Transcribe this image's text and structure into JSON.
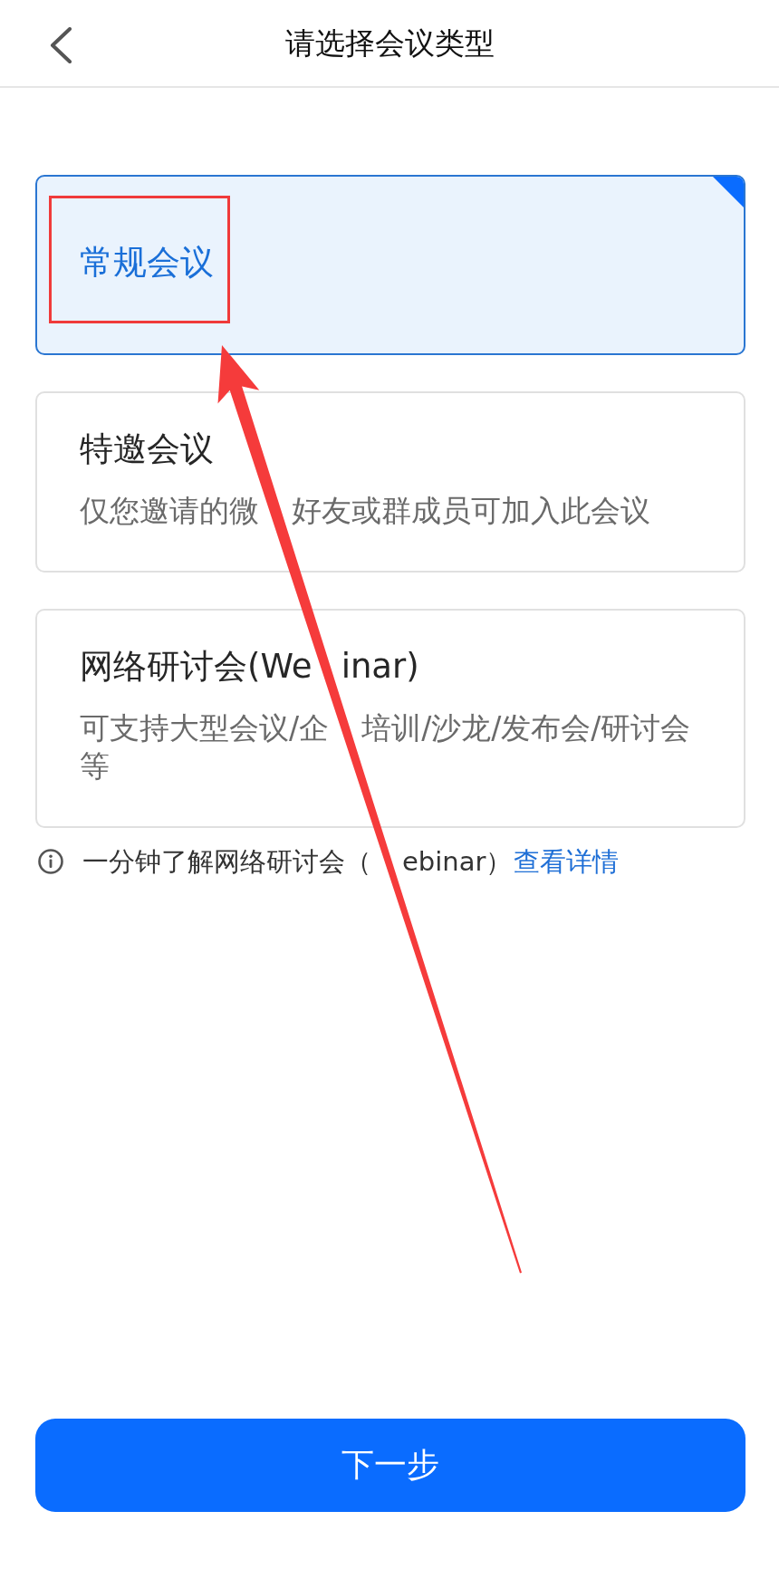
{
  "header": {
    "title": "请选择会议类型"
  },
  "meeting_types": [
    {
      "title": [
        "常规会议"
      ],
      "selected": true,
      "highlighted": true
    },
    {
      "title": [
        "特邀会议"
      ],
      "description": [
        "仅您邀请的微",
        "好友或群成员可加入此会议"
      ],
      "selected": false,
      "highlighted": false
    },
    {
      "title": [
        "网络研讨会(We",
        "inar)"
      ],
      "description": [
        "可支持大型会议/企",
        "培训/沙龙/发布会/研讨会等"
      ],
      "selected": false,
      "highlighted": false
    }
  ],
  "info": {
    "text": [
      "一分钟了解网络研讨会（",
      "ebinar）"
    ],
    "link": "查看详情"
  },
  "next_button": {
    "label": "下一步"
  },
  "annotation_arrow": true
}
